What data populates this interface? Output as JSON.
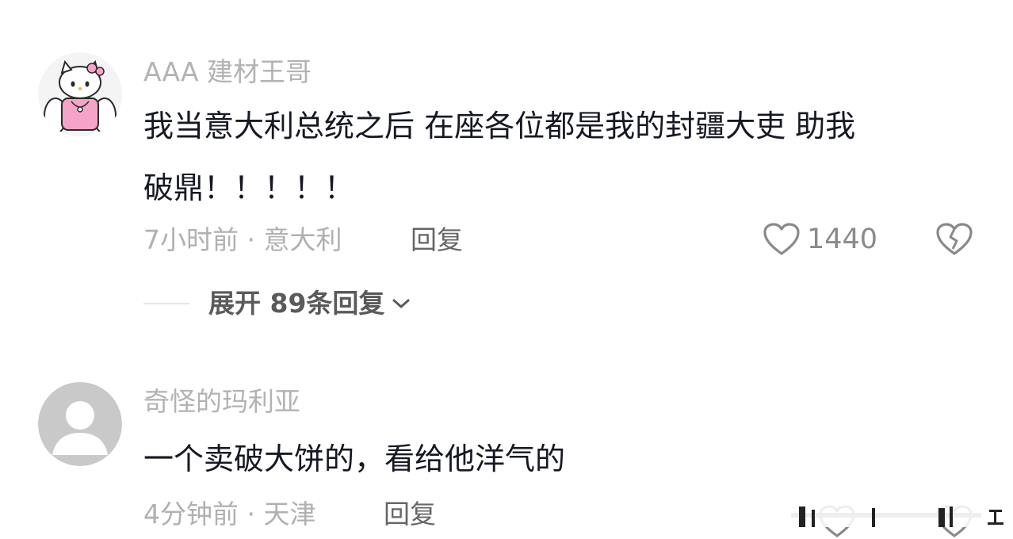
{
  "comments": [
    {
      "username": "AAA 建材王哥",
      "text_lines": [
        "我当意大利总统之后 在座各位都是我的封疆大吏 助我",
        "破鼎！！！！！"
      ],
      "time": "7小时前",
      "location": "意大利",
      "meta_sep": " · ",
      "reply_label": "回复",
      "like_count": "1440",
      "expand_label": "展开 89条回复"
    },
    {
      "username": "奇怪的玛利亚",
      "text_lines": [
        "一个卖破大饼的，看给他洋气的"
      ],
      "time": "4分钟前",
      "location": "天津",
      "meta_sep": " · ",
      "reply_label": "回复"
    }
  ],
  "icons": {
    "like": "heart-outline-icon",
    "dislike": "broken-heart-icon",
    "expand": "chevron-down-icon"
  },
  "colors": {
    "username": "#b3b3b3",
    "text": "#161823",
    "meta": "#b0b0b0",
    "avatar_default": "#c9c9c9",
    "hello_kitty_pink": "#f5a3c7"
  }
}
